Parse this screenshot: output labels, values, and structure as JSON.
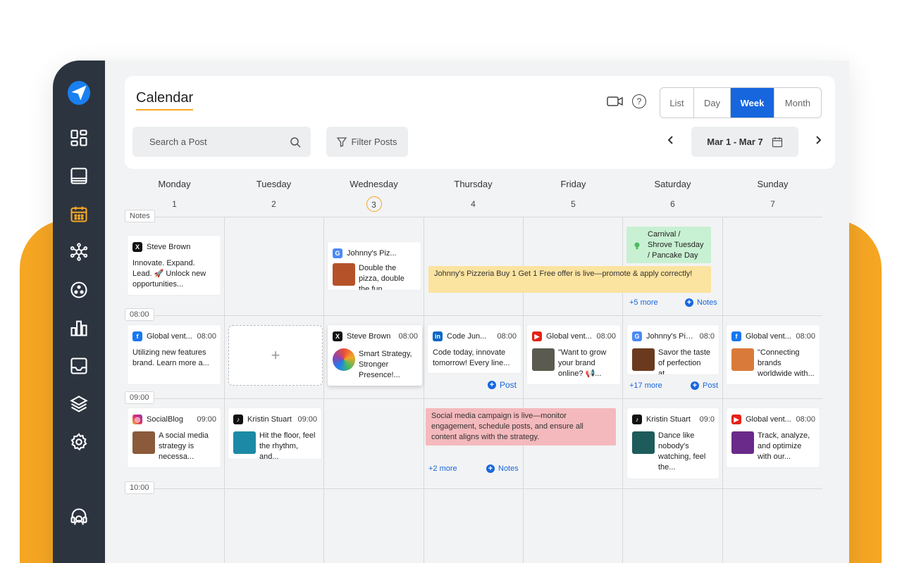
{
  "header": {
    "title": "Calendar",
    "help": "?",
    "view_tabs": [
      "List",
      "Day",
      "Week",
      "Month"
    ],
    "active_view": "Week",
    "search_placeholder": "Search a Post",
    "filter_label": "Filter Posts",
    "date_range": "Mar 1 - Mar 7"
  },
  "days": [
    {
      "name": "Monday",
      "num": "1"
    },
    {
      "name": "Tuesday",
      "num": "2"
    },
    {
      "name": "Wednesday",
      "num": "3"
    },
    {
      "name": "Thursday",
      "num": "4"
    },
    {
      "name": "Friday",
      "num": "5"
    },
    {
      "name": "Saturday",
      "num": "6"
    },
    {
      "name": "Sunday",
      "num": "7"
    }
  ],
  "time_labels": [
    "Notes",
    "08:00",
    "09:00",
    "10:00"
  ],
  "notes_row": {
    "mon_card": {
      "name": "Steve Brown",
      "text": "Innovate. Expand. Lead. 🚀 Unlock new opportunities..."
    },
    "wed_card": {
      "name": "Johnny's Piz...",
      "text": "Double the pizza, double the fun..."
    },
    "sat_note": "Carnival / Shrove Tuesday / Pancake Day",
    "banner": "Johnny's Pizzeria Buy 1 Get 1 Free offer is live—promote & apply correctly!",
    "more": "+5 more",
    "notes_link": "Notes"
  },
  "row_0800": {
    "mon": {
      "name": "Global vent...",
      "time": "08:00",
      "text": "Utilizing new features brand. Learn more a..."
    },
    "wed": {
      "name": "Steve Brown",
      "time": "08:00",
      "text": "Smart Strategy, Stronger Presence!..."
    },
    "thu": {
      "name": "Code Jun...",
      "time": "08:00",
      "text": "Code today, innovate tomorrow! Every line..."
    },
    "fri": {
      "name": "Global vent...",
      "time": "08:00",
      "text": "\"Want to grow your brand online? 📢..."
    },
    "sat": {
      "name": "Johnny's Piz...",
      "time": "08:0",
      "text": "Savor the taste of perfection at..."
    },
    "sun": {
      "name": "Global vent...",
      "time": "08:00",
      "text": "\"Connecting brands worldwide with..."
    },
    "post_link": "Post",
    "sat_more": "+17 more",
    "sat_post": "Post",
    "add": "+"
  },
  "row_0900": {
    "mon": {
      "name": "SocialBlog",
      "time": "09:00",
      "text": "A social media strategy is necessa..."
    },
    "tue": {
      "name": "Kristin Stuart",
      "time": "09:00",
      "text": "Hit the floor, feel the rhythm, and..."
    },
    "sat": {
      "name": "Kristin Stuart",
      "time": "09:0",
      "text": "Dance like nobody's watching, feel the..."
    },
    "sun": {
      "name": "Global vent...",
      "time": "08:00",
      "text": "Track, analyze, and optimize with our..."
    },
    "banner": "Social media campaign is live—monitor engagement, schedule posts, and ensure all content aligns with the strategy.",
    "more": "+2 more",
    "notes_link": "Notes"
  },
  "colors": {
    "accent": "#1766de",
    "brand_orange": "#F5A623",
    "sidebar": "#2c3440",
    "banner_yellow": "#fbe3a0",
    "banner_red": "#f4b9bd",
    "note_green": "#c8f0d2"
  }
}
